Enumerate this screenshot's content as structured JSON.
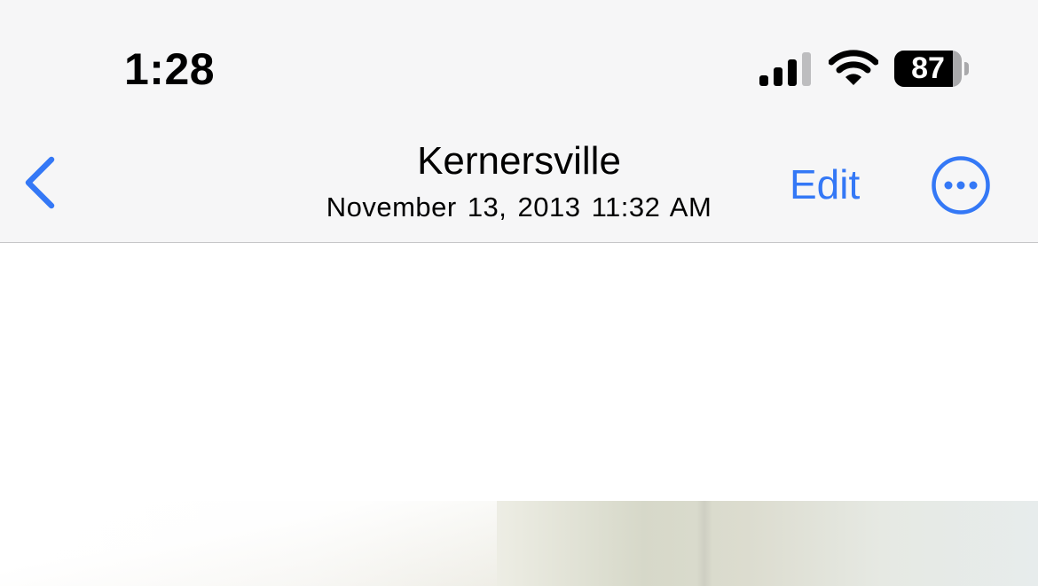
{
  "status_bar": {
    "time": "1:28",
    "battery_level": "87",
    "battery_fraction": 0.87,
    "signal_bars_active": 3,
    "signal_bars_total": 4,
    "icons": [
      "cellular-signal-icon",
      "wifi-icon",
      "battery-icon"
    ]
  },
  "nav": {
    "back_icon": "chevron-left-icon",
    "title": "Kernersville",
    "subtitle": "November 13, 2013  11:32 AM",
    "edit_label": "Edit",
    "more_icon": "ellipsis-circle-icon"
  },
  "colors": {
    "accent": "#3478f6",
    "chrome_background": "#f6f6f7",
    "divider": "#c6c6c8",
    "text": "#000000"
  }
}
